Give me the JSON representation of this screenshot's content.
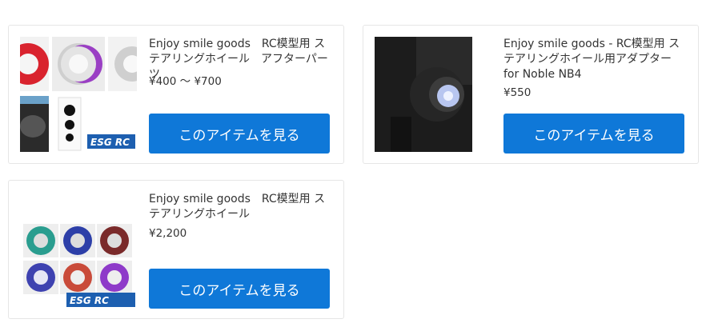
{
  "items": [
    {
      "title": "Enjoy smile goods　RC模型用 ステアリングホイール　アフターパーツ",
      "price": "¥400 ～ ¥700",
      "button_label": "このアイテムを見る"
    },
    {
      "title": "Enjoy smile goods - RC模型用 ステアリングホイール用アダプター for Noble NB4",
      "price": "¥550",
      "button_label": "このアイテムを見る"
    },
    {
      "title": "Enjoy smile goods　RC模型用 ステアリングホイール",
      "price": "¥2,200",
      "button_label": "このアイテムを見る"
    }
  ],
  "colors": {
    "button": "#0f78d8",
    "border": "#e6e6e6",
    "text": "#333333"
  }
}
